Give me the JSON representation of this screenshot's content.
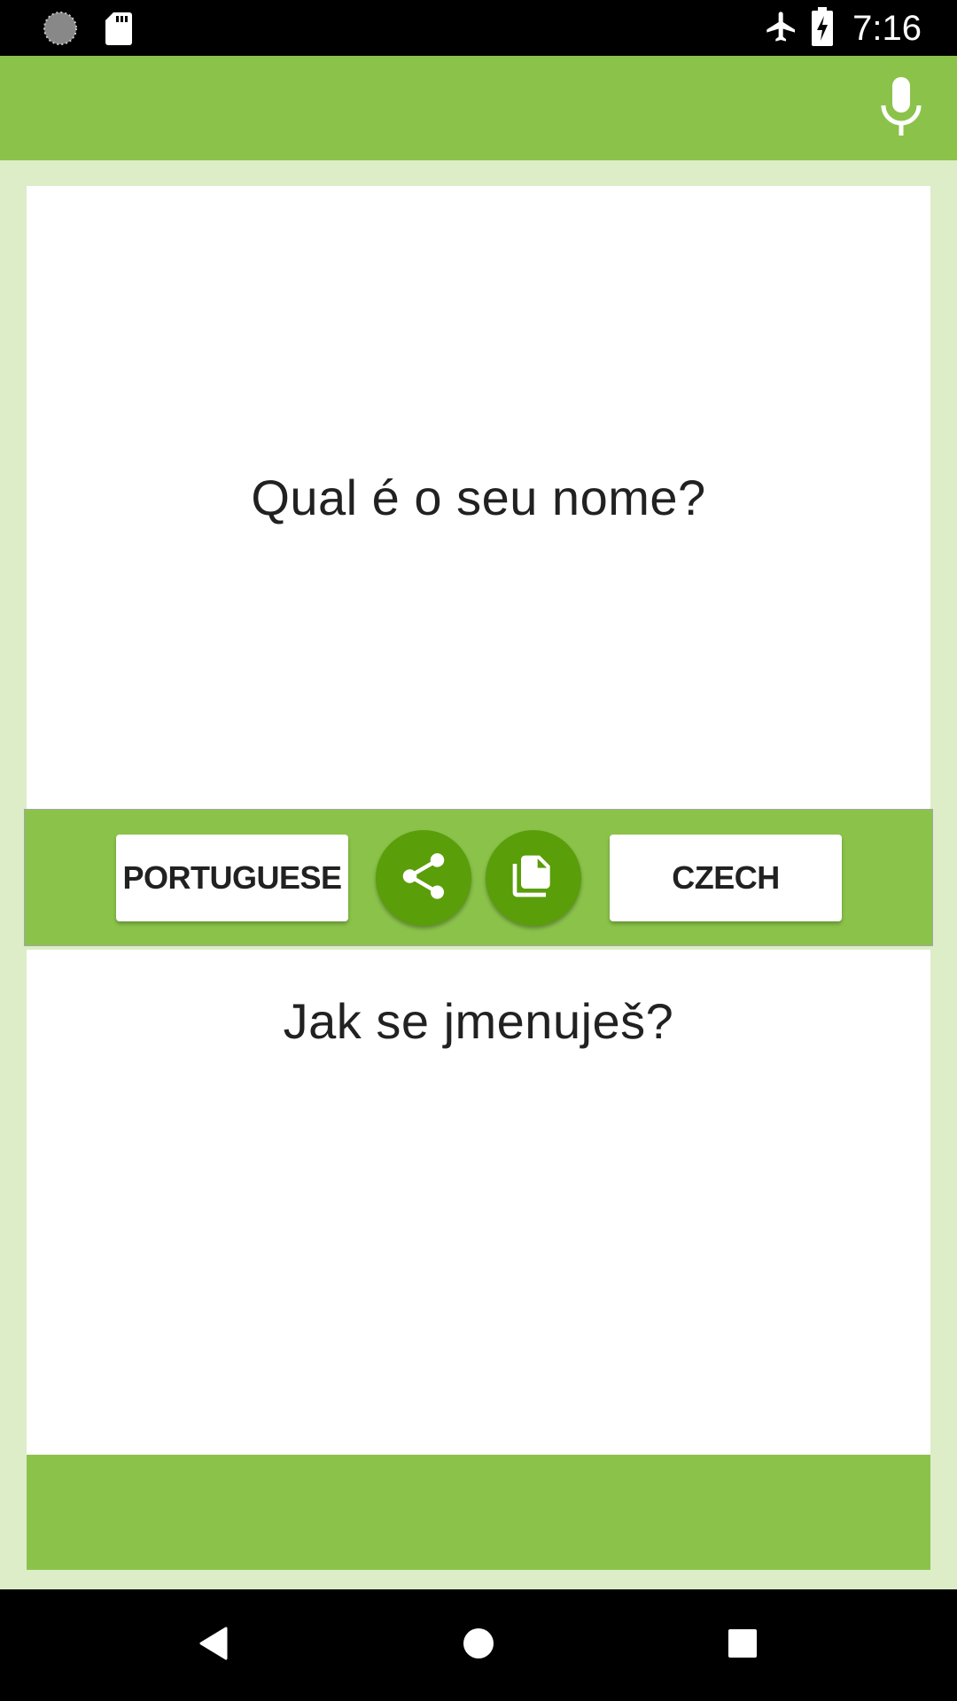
{
  "status_bar": {
    "left_icons": [
      "loading-spinner-icon",
      "sd-card-icon"
    ],
    "right_icons": [
      "airplane-mode-icon",
      "battery-charging-icon"
    ],
    "time": "7:16"
  },
  "app_bar": {
    "action_icon": "microphone-icon"
  },
  "source": {
    "text": "Qual é o seu nome?"
  },
  "controls": {
    "source_language": "PORTUGUESE",
    "target_language": "CZECH",
    "share_icon": "share-icon",
    "copy_icon": "copy-icon"
  },
  "translation": {
    "text": "Jak se jmenuješ?"
  },
  "colors": {
    "primary": "#8bc34a",
    "primary_dark": "#5a9e0a",
    "background": "#dcedc8",
    "text": "#212121"
  },
  "nav_bar": {
    "buttons": [
      "back-icon",
      "home-icon",
      "recents-icon"
    ]
  }
}
